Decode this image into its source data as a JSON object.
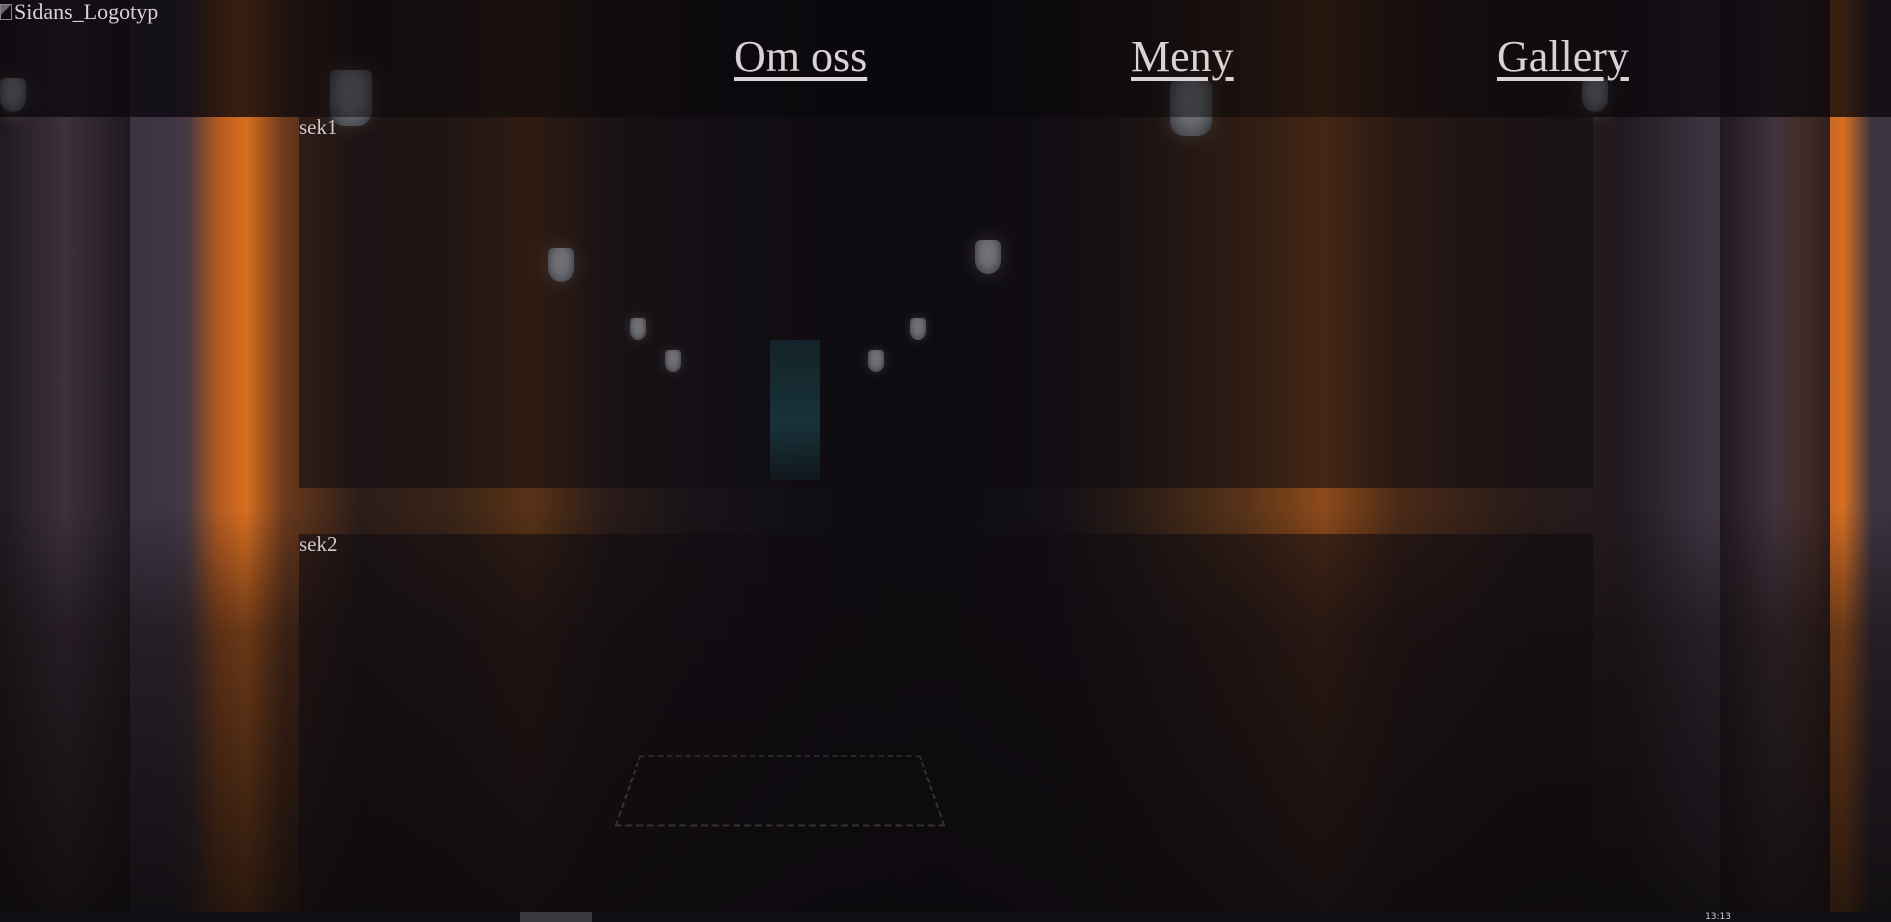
{
  "header": {
    "logo_alt": "Sidans_Logotyp",
    "nav": [
      {
        "label": "Om oss"
      },
      {
        "label": "Meny"
      },
      {
        "label": "Gallery"
      }
    ]
  },
  "sections": [
    {
      "label": "sek1"
    },
    {
      "label": "sek2"
    }
  ],
  "taskbar": {
    "clock": "13:13"
  },
  "colors": {
    "nav_text": "#d8d2d6",
    "header_bg": "#0a080c",
    "section_bg": "#100c12",
    "accent_lamp": "#d86f20"
  },
  "background": {
    "icon": "photo-night-arcade"
  }
}
